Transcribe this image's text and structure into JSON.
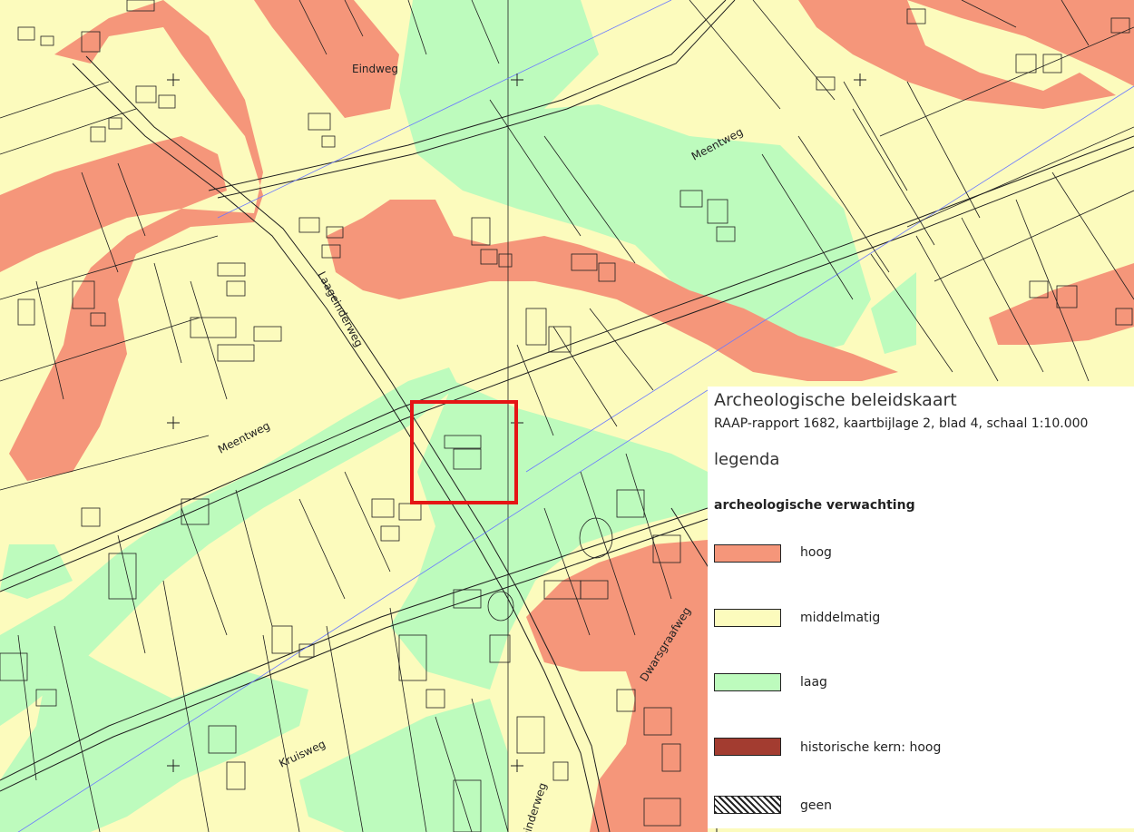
{
  "colors": {
    "hoog": "#f5967a",
    "middelmatig": "#fcfbbd",
    "laag": "#bdfbbd",
    "historische_kern": "#a33c30",
    "highlight": "#e51515"
  },
  "map": {
    "road_labels": [
      "Eindweg",
      "Meentweg",
      "Laageinderweg",
      "Meentweg",
      "Kruisweg",
      "Dwarsgraafweg",
      "Laageinderweg"
    ],
    "highlight_box": "selected-parcel"
  },
  "legend": {
    "title": "Archeologische beleidskaart",
    "subtitle": "RAAP-rapport 1682, kaartbijlage 2, blad 4, schaal 1:10.000",
    "heading": "legenda",
    "section": "archeologische  verwachting",
    "items": [
      {
        "label": "hoog",
        "swatch": "hoog"
      },
      {
        "label": "middelmatig",
        "swatch": "middelmatig"
      },
      {
        "label": "laag",
        "swatch": "laag"
      },
      {
        "label": "historische kern: hoog",
        "swatch": "historische_kern"
      },
      {
        "label": "geen",
        "swatch": "hatched"
      }
    ]
  }
}
